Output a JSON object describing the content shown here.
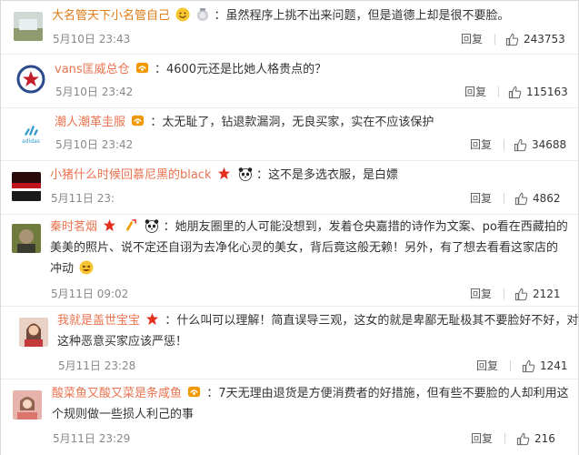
{
  "colors": {
    "username": "#e07b16",
    "text": "#333333",
    "time": "#888888",
    "divider": "#d5d5d5"
  },
  "comments": [
    {
      "username": "大名管天下小名管自己",
      "text": "虽然程序上挑不出来问题，但是道德上却是很不要脸。",
      "time": "5月10日 23:43",
      "reply": "回复",
      "likes": "243753",
      "badges": [
        "smile-emoji",
        "medal-icon"
      ]
    },
    {
      "username": "vans匡威总仓",
      "text": "4600元还是比她人格贵点的？",
      "time": "5月10日 23:42",
      "reply": "回复",
      "likes": "115163",
      "badges": [
        "fan-badge-icon"
      ]
    },
    {
      "username": "潮人潮革圭服",
      "text": "太无耻了，钻退款漏洞，无良买家，实在不应该保护",
      "time": "5月10日 23:42",
      "reply": "回复",
      "likes": "34688",
      "badges": [
        "fan-badge-icon"
      ]
    },
    {
      "username": "小猪什么时候回慕尼黑的black",
      "text": "这不是多选衣服，是白嫖",
      "time": "5月11日 23:",
      "reply": "回复",
      "likes": "4862",
      "badges": [
        "star-icon",
        "panda-icon"
      ]
    },
    {
      "username": "秦时茗烟",
      "text_lines": [
        "她朋友圈里的人可能没想到，发着仓央嘉措的诗作为文案、po看在西藏拍的",
        "美美的照片、说不定还自诩为去净化心灵的美女，背后竟这般无赖！另外，有了想去看看这家店的",
        "冲动"
      ],
      "time": "5月11日 09:02",
      "reply": "回复",
      "likes": "2121",
      "badges": [
        "star-icon",
        "sparkle-icon",
        "panda-icon"
      ]
    },
    {
      "username": "我就是盖世宝宝",
      "text_lines": [
        "什么叫可以理解！简直误导三观，这女的就是卑鄙无耻极其不要脸好不好，对",
        "这种恶意买家应该严惩！"
      ],
      "time": "5月11日 23:28",
      "reply": "回复",
      "likes": "1241",
      "badges": [
        "star-icon"
      ]
    },
    {
      "username": "酸菜鱼又酸又菜是条咸鱼",
      "text_lines": [
        "7天无理由退货是方便消费者的好措施，但有些不要脸的人却利用这",
        "个规则做一些损人利己的事"
      ],
      "time": "5月11日 23:29",
      "reply": "回复",
      "likes": "216",
      "badges": [
        "fan-badge-icon"
      ]
    }
  ]
}
